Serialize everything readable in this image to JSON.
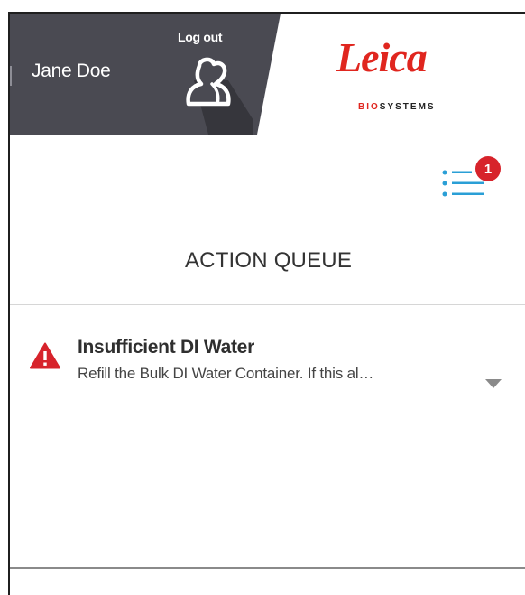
{
  "user": {
    "name": "Jane Doe",
    "logout_label": "Log out",
    "avatar_icon": "user-avatar-icon"
  },
  "brand": {
    "wordmark": "Leica",
    "tagline_prefix": "BIO",
    "tagline_suffix": "SYSTEMS",
    "color": "#e0261f"
  },
  "queue_button": {
    "icon": "list-icon",
    "badge_count": "1",
    "badge_color": "#d7232b",
    "icon_color": "#2a9fd6"
  },
  "action_queue": {
    "title": "ACTION QUEUE",
    "items": [
      {
        "icon": "warning-icon",
        "title": "Insufficient DI Water",
        "description": "Refill the Bulk DI Water Container. If this al…",
        "expand_icon": "chevron-down-icon"
      }
    ]
  },
  "colors": {
    "header_bg": "#4a4a52",
    "warning": "#d7232b",
    "divider": "#d6d6d6"
  }
}
